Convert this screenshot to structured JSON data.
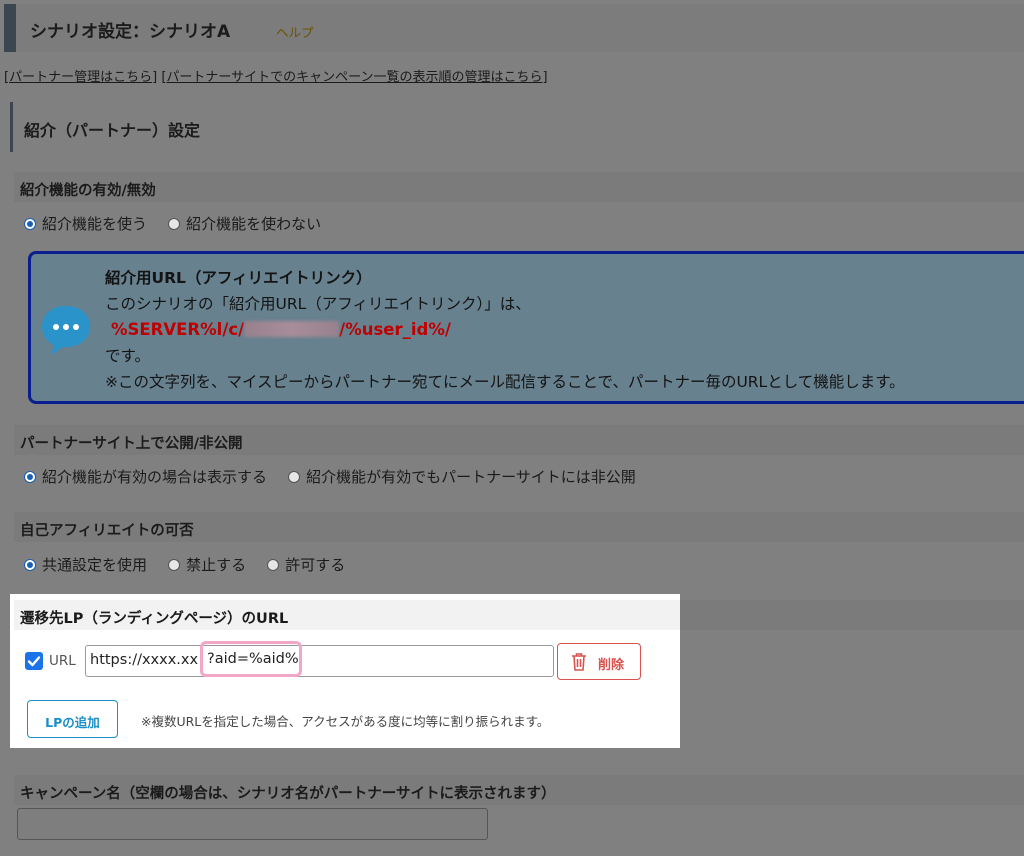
{
  "header": {
    "title": "シナリオ設定：シナリオA",
    "help": "ヘルプ"
  },
  "links": {
    "open1": "[",
    "partner_manage": "パートナー管理はこちら",
    "close1": "]",
    "open2": "[",
    "campaign_order": "パートナーサイトでのキャンペーン一覧の表示順の管理はこちら",
    "close2": "]"
  },
  "section": {
    "title": "紹介（パートナー）設定"
  },
  "referral": {
    "label": "紹介機能の有効/無効",
    "options": [
      "紹介機能を使う",
      "紹介機能を使わない"
    ],
    "selected": 0
  },
  "info": {
    "title": "紹介用URL（アフィリエイトリンク）",
    "line1": "このシナリオの「紹介用URL（アフィリエイトリンク）」は、",
    "url_prefix": "%SERVER%l/c/",
    "url_suffix": "/%user_id%/",
    "line3": "です。",
    "line4": "※この文字列を、マイスピーからパートナー宛てにメール配信することで、パートナー毎のURLとして機能します。"
  },
  "publish": {
    "label": "パートナーサイト上で公開/非公開",
    "options": [
      "紹介機能が有効の場合は表示する",
      "紹介機能が有効でもパートナーサイトには非公開"
    ],
    "selected": 0
  },
  "self_affiliate": {
    "label": "自己アフィリエイトの可否",
    "options": [
      "共通設定を使用",
      "禁止する",
      "許可する"
    ],
    "selected": 0
  },
  "lp": {
    "label": "遷移先LP（ランディングページ）のURL",
    "checkbox_label": "URL",
    "url_value": "https://xxxx.xx",
    "url_highlight": "?aid=%aid%",
    "delete_label": "削除",
    "add_label": "LPの追加",
    "note": "※複数URLを指定した場合、アクセスがある度に均等に割り振られます。"
  },
  "campaign": {
    "label": "キャンペーン名（空欄の場合は、シナリオ名がパートナーサイトに表示されます）",
    "value": ""
  },
  "colors": {
    "highlight_border": "#f2a6c8",
    "delete_red": "#d9534f",
    "add_blue": "#1a8fc7",
    "url_red": "#c00000",
    "info_border": "#0a1f8f",
    "checkbox_blue": "#1a73e8"
  }
}
